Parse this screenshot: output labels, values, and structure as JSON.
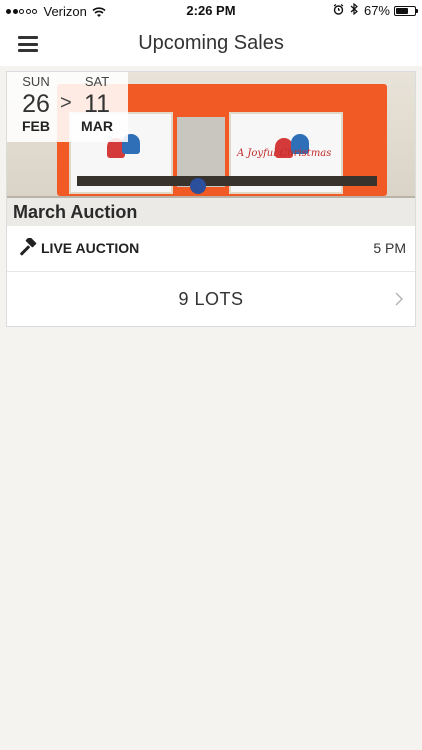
{
  "status_bar": {
    "carrier": "Verizon",
    "time": "2:26 PM",
    "battery_percent": "67%",
    "battery_level": 0.67,
    "signal_bars_filled": 2,
    "signal_bars_total": 5
  },
  "nav": {
    "title": "Upcoming Sales",
    "menu_icon": "hamburger-menu-icon"
  },
  "sale": {
    "title": "March Auction",
    "start": {
      "dow": "SUN",
      "day": "26",
      "month": "FEB"
    },
    "separator": ">",
    "end": {
      "dow": "SAT",
      "day": "11",
      "month": "MAR"
    },
    "type_label": "LIVE AUCTION",
    "type_icon": "gavel-icon",
    "time": "5 PM",
    "lots_label": "9 LOTS",
    "image_script_text": "A Joyful Christmas"
  },
  "colors": {
    "background": "#f4f3ef",
    "card": "#ffffff",
    "railcar_orange": "#f15a24"
  }
}
